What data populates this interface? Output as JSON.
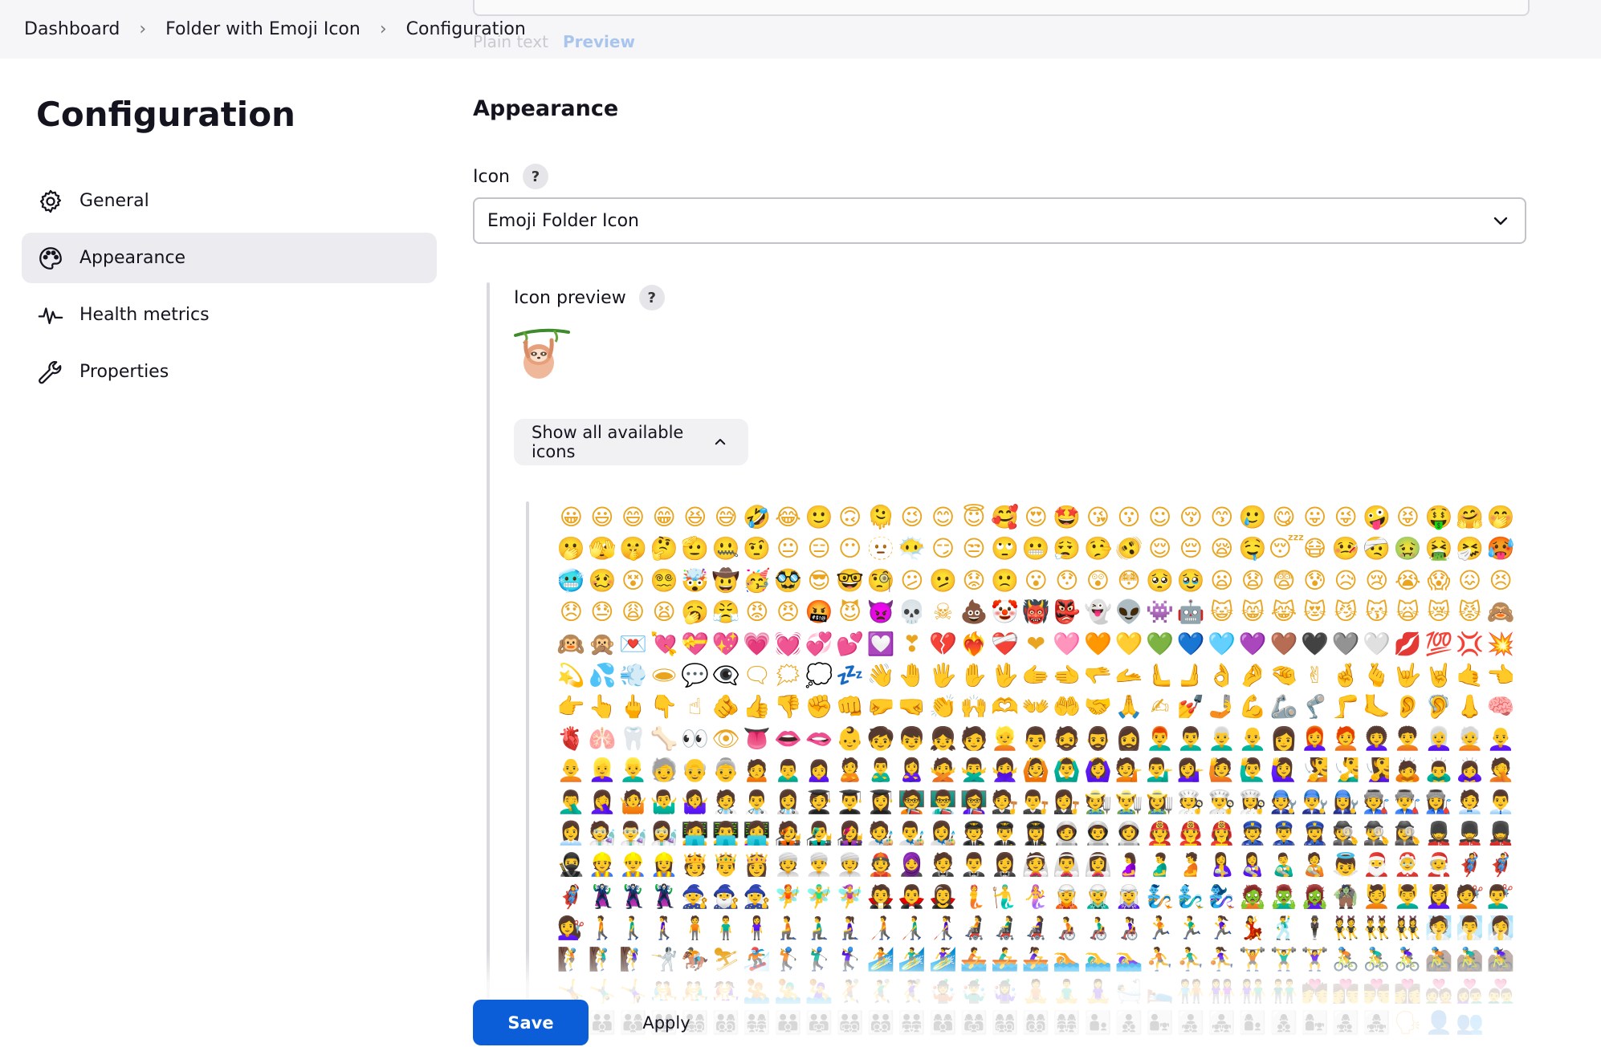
{
  "breadcrumb": {
    "items": [
      "Dashboard",
      "Folder with Emoji Icon",
      "Configuration"
    ],
    "separator": "›"
  },
  "previous_field": {
    "tab_plain": "Plain text",
    "tab_preview": "Preview"
  },
  "sidebar": {
    "title": "Configuration",
    "items": [
      {
        "label": "General",
        "icon": "gear-icon",
        "active": false
      },
      {
        "label": "Appearance",
        "icon": "palette-icon",
        "active": true
      },
      {
        "label": "Health metrics",
        "icon": "pulse-icon",
        "active": false
      },
      {
        "label": "Properties",
        "icon": "wrench-icon",
        "active": false
      }
    ]
  },
  "main": {
    "section_title": "Appearance",
    "icon_field": {
      "label": "Icon",
      "help": "?",
      "selected": "Emoji Folder Icon"
    },
    "icon_preview": {
      "label": "Icon preview",
      "help": "?",
      "icon": "sloth-emoji"
    },
    "show_all_button": "Show all available icons",
    "icon_grid": {
      "columns": 31,
      "rows": [
        "😀😃😄😁😆😅🤣😂🙂🙃🫠😉😊😇🥰😍🤩😘😗☺😚😙🥲😋😛😜🤪😝🤑🤗🤭",
        "🫢🫣🤫🤔🫡🤐🤨😐😑😶🫥😶‍🌫️😏😒🙄😬😮‍💨🤥🫨😌😔😪🤤😴😷🤒🤕🤢🤮🤧🥵",
        "🥶🥴😵😵‍💫🤯🤠🥳🥸😎🤓🧐😕🫤😟🙁😮😯😲😳🥺🥹😦😧😨😰😥😢😭😱😖😣",
        "😞😓😩😫🥱😤😡😠🤬😈👿💀☠💩🤡👹👺👻👽👾🤖😺😸😹😻😼😽🙀😿😾🙈",
        "🙉🙊💌💘💝💖💗💓💞💕💟❣💔❤️‍🔥❤‍🩹❤🩷🧡💛💚💙🩵💜🤎🖤🩶🤍💋💯💢💥",
        "💫💦💨🕳💬👁‍🗨🗨🗯💭💤👋🤚🖐✋🖖🫱🫲🫳🫴🫷🫸👌🤌🤏✌🤞🫰🤟🤘🤙👈",
        "👉👆🖕👇☝🫵👍👎✊👊🤛🤜👏🙌🫶👐🤲🤝🙏✍💅🤳💪🦾🦿🦵🦶👂🦻👃🧠",
        "🫀🫁🦷🦴👀👁👅👄🫦👶🧒👦👧🧑👱👨🧔🧔‍♂️🧔‍♀️👨‍🦰👨‍🦱👨‍🦳👨‍🦲👩👩‍🦰🧑‍🦰👩‍🦱🧑‍🦱👩‍🦳🧑‍🦳👩‍🦲",
        "🧑‍🦲👱‍♀️👱‍♂️🧓👴👵🙍🙍‍♂️🙍‍♀️🙎🙎‍♂️🙎‍♀️🙅🙅‍♂️🙅‍♀️🙆🙆‍♂️🙆‍♀️💁💁‍♂️💁‍♀️🙋🙋‍♂️🙋‍♀️🧏🧏‍♂️🧏‍♀️🙇🙇‍♂️🙇‍♀️🤦",
        "🤦‍♂️🤦‍♀️🤷🤷‍♂️🤷‍♀️🧑‍⚕️👨‍⚕️👩‍⚕️🧑‍🎓👨‍🎓👩‍🎓🧑‍🏫👨‍🏫👩‍🏫🧑‍⚖️👨‍⚖️👩‍⚖️🧑‍🌾👨‍🌾👩‍🌾🧑‍🍳👨‍🍳👩‍🍳🧑‍🔧👨‍🔧👩‍🔧🧑‍🏭👨‍🏭👩‍🏭🧑‍💼👨‍💼",
        "👩‍💼🧑‍🔬👨‍🔬👩‍🔬🧑‍💻👨‍💻👩‍💻🧑‍🎤👨‍🎤👩‍🎤🧑‍🎨👨‍🎨👩‍🎨🧑‍✈️👨‍✈️👩‍✈️🧑‍🚀👨‍🚀👩‍🚀🧑‍🚒👨‍🚒👩‍🚒👮👮‍♂️👮‍♀️🕵🕵️‍♂️🕵️‍♀️💂💂‍♂️💂‍♀️",
        "🥷👷👷‍♂️👷‍♀️🫅🤴👸👳👳‍♂️👳‍♀️👲🧕🤵🤵‍♂️🤵‍♀️👰👰‍♂️👰‍♀️🤰🫃🫄🤱👩‍🍼👨‍🍼🧑‍🍼👼🎅🤶🧑‍🎄🦸🦸‍♂️",
        "🦸‍♀️🦹🦹‍♂️🦹‍♀️🧙🧙‍♂️🧙‍♀️🧚🧚‍♂️🧚‍♀️🧛🧛‍♂️🧛‍♀️🧜🧜‍♂️🧜‍♀️🧝🧝‍♂️🧝‍♀️🧞🧞‍♂️🧞‍♀️🧟🧟‍♂️🧟‍♀️🧌💆💆‍♂️💆‍♀️💇💇‍♂️",
        "💇‍♀️🚶🚶‍♂️🚶‍♀️🧍🧍‍♂️🧍‍♀️🧎🧎‍♂️🧎‍♀️🧑‍🦯👨‍🦯👩‍🦯🧑‍🦼👨‍🦼👩‍🦼🧑‍🦽👨‍🦽👩‍🦽🏃🏃‍♂️🏃‍♀️💃🕺🕴👯👯‍♂️👯‍♀️🧖🧖‍♂️🧖‍♀️",
        "🧗🧗‍♂️🧗‍♀️🤺🏇⛷🏂🏌🏌️‍♂️🏌️‍♀️🏄🏄‍♂️🏄‍♀️🚣🚣‍♂️🚣‍♀️🏊🏊‍♂️🏊‍♀️⛹⛹️‍♂️⛹️‍♀️🏋🏋️‍♂️🏋️‍♀️🚴🚴‍♂️🚴‍♀️🚵🚵‍♂️🚵‍♀️",
        "🤸🤸‍♂️🤸‍♀️🤼🤼‍♂️🤼‍♀️🤽🤽‍♂️🤽‍♀️🤾🤾‍♂️🤾‍♀️🤹🤹‍♂️🤹‍♀️🧘🧘‍♂️🧘‍♀️🛀🛌🧑‍🤝‍🧑👭👫👬💏👩‍❤️‍💋‍👨👨‍❤️‍💋‍👨👩‍❤️‍💋‍👩💑👩‍❤️‍👨",
        "👨‍❤️‍👨👩‍❤️‍👩👪👨‍👩‍👦👨‍👩‍👧👨‍👩‍👧‍👦👨‍👩‍👦‍👦👨‍👩‍👧‍👧👨‍👨‍👦👨‍👨‍👧👨‍👨‍👧‍👦👨‍👨‍👦‍👦👨‍👨‍👧‍👧👩‍👩‍👦👩‍👩‍👧👩‍👩‍👧‍👦👩‍👩‍👦‍👦👩‍👩‍👧‍👧👨‍👦👨‍👦‍👦👨‍👧👨‍👧‍👦👨‍👧‍👧👩‍👦👩‍👦‍👦👩‍👧👩‍👧‍👦👩‍👧‍👧🗣👤👥"
      ]
    }
  },
  "actions": {
    "save": "Save",
    "apply": "Apply"
  },
  "colors": {
    "primary": "#0b5ed7",
    "active_nav": "#ececf0",
    "topbar": "#f6f6f8"
  }
}
